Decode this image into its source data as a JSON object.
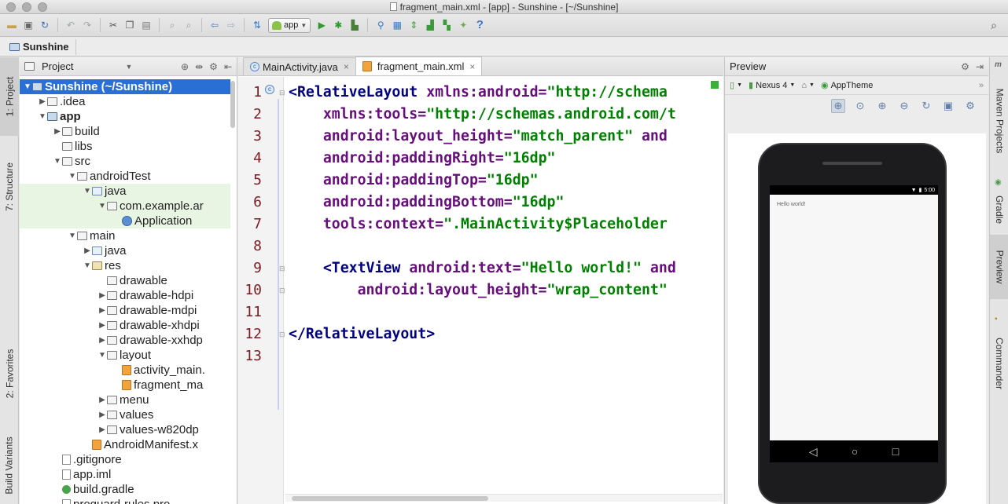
{
  "window": {
    "title": "fragment_main.xml - [app] - Sunshine - [~/Sunshine]"
  },
  "toolbar": {
    "run_config": "app",
    "help_glyph": "?"
  },
  "breadcrumb": {
    "project": "Sunshine"
  },
  "left_stripe": {
    "tabs": [
      "1: Project",
      "7: Structure",
      "2: Favorites",
      "Build Variants"
    ]
  },
  "project_panel": {
    "view": "Project",
    "tree": [
      {
        "label": "Sunshine (~/Sunshine)",
        "depth": 0,
        "expanded": true,
        "icon": "module-folder-icon",
        "selected": true
      },
      {
        "label": ".idea",
        "depth": 1,
        "expanded": false,
        "icon": "folder-icon"
      },
      {
        "label": "app",
        "depth": 1,
        "expanded": true,
        "icon": "module-folder-icon",
        "bold": true
      },
      {
        "label": "build",
        "depth": 2,
        "expanded": false,
        "icon": "folder-icon"
      },
      {
        "label": "libs",
        "depth": 2,
        "icon": "folder-icon"
      },
      {
        "label": "src",
        "depth": 2,
        "expanded": true,
        "icon": "folder-icon"
      },
      {
        "label": "androidTest",
        "depth": 3,
        "expanded": true,
        "icon": "folder-icon"
      },
      {
        "label": "java",
        "depth": 4,
        "expanded": true,
        "icon": "source-folder-icon",
        "green": true
      },
      {
        "label": "com.example.ar",
        "depth": 5,
        "expanded": true,
        "icon": "package-icon",
        "green": true
      },
      {
        "label": "Application",
        "depth": 6,
        "icon": "class-icon",
        "green": true
      },
      {
        "label": "main",
        "depth": 3,
        "expanded": true,
        "icon": "folder-icon"
      },
      {
        "label": "java",
        "depth": 4,
        "expanded": false,
        "icon": "source-folder-icon"
      },
      {
        "label": "res",
        "depth": 4,
        "expanded": true,
        "icon": "res-folder-icon"
      },
      {
        "label": "drawable",
        "depth": 5,
        "icon": "folder-icon"
      },
      {
        "label": "drawable-hdpi",
        "depth": 5,
        "expanded": false,
        "icon": "folder-icon"
      },
      {
        "label": "drawable-mdpi",
        "depth": 5,
        "expanded": false,
        "icon": "folder-icon"
      },
      {
        "label": "drawable-xhdpi",
        "depth": 5,
        "expanded": false,
        "icon": "folder-icon"
      },
      {
        "label": "drawable-xxhdp",
        "depth": 5,
        "expanded": false,
        "icon": "folder-icon"
      },
      {
        "label": "layout",
        "depth": 5,
        "expanded": true,
        "icon": "folder-icon"
      },
      {
        "label": "activity_main.",
        "depth": 6,
        "icon": "xml-file-icon"
      },
      {
        "label": "fragment_ma",
        "depth": 6,
        "icon": "xml-file-icon"
      },
      {
        "label": "menu",
        "depth": 5,
        "expanded": false,
        "icon": "folder-icon"
      },
      {
        "label": "values",
        "depth": 5,
        "expanded": false,
        "icon": "folder-icon"
      },
      {
        "label": "values-w820dp",
        "depth": 5,
        "expanded": false,
        "icon": "folder-icon"
      },
      {
        "label": "AndroidManifest.x",
        "depth": 4,
        "icon": "xml-file-icon"
      },
      {
        "label": ".gitignore",
        "depth": 2,
        "icon": "file-icon"
      },
      {
        "label": "app.iml",
        "depth": 2,
        "icon": "file-icon"
      },
      {
        "label": "build.gradle",
        "depth": 2,
        "icon": "gradle-icon"
      },
      {
        "label": "proguard-rules.pro",
        "depth": 2,
        "icon": "file-icon"
      }
    ]
  },
  "editor": {
    "tabs": [
      {
        "label": "MainActivity.java",
        "active": false,
        "icon": "java-class-icon"
      },
      {
        "label": "fragment_main.xml",
        "active": true,
        "icon": "xml-file-icon"
      }
    ],
    "close_glyph": "×",
    "line_numbers": [
      "1",
      "2",
      "3",
      "4",
      "5",
      "6",
      "7",
      "8",
      "9",
      "10",
      "11",
      "12",
      "13"
    ],
    "lines": [
      [
        {
          "t": "tag",
          "s": "<RelativeLayout "
        },
        {
          "t": "attr",
          "s": "xmlns:android="
        },
        {
          "t": "val",
          "s": "\"http://schema"
        }
      ],
      [
        {
          "t": "plain",
          "s": "    "
        },
        {
          "t": "attr",
          "s": "xmlns:tools="
        },
        {
          "t": "val",
          "s": "\"http://schemas.android.com/t"
        }
      ],
      [
        {
          "t": "plain",
          "s": "    "
        },
        {
          "t": "attr",
          "s": "android:layout_height="
        },
        {
          "t": "val",
          "s": "\"match_parent\""
        },
        {
          "t": "attr",
          "s": " and"
        }
      ],
      [
        {
          "t": "plain",
          "s": "    "
        },
        {
          "t": "attr",
          "s": "android:paddingRight="
        },
        {
          "t": "val",
          "s": "\"16dp\""
        }
      ],
      [
        {
          "t": "plain",
          "s": "    "
        },
        {
          "t": "attr",
          "s": "android:paddingTop="
        },
        {
          "t": "val",
          "s": "\"16dp\""
        }
      ],
      [
        {
          "t": "plain",
          "s": "    "
        },
        {
          "t": "attr",
          "s": "android:paddingBottom="
        },
        {
          "t": "val",
          "s": "\"16dp\""
        }
      ],
      [
        {
          "t": "plain",
          "s": "    "
        },
        {
          "t": "attr",
          "s": "tools:context="
        },
        {
          "t": "val",
          "s": "\".MainActivity$Placeholder"
        }
      ],
      [],
      [
        {
          "t": "plain",
          "s": "    "
        },
        {
          "t": "tag",
          "s": "<TextView "
        },
        {
          "t": "attr",
          "s": "android:text="
        },
        {
          "t": "val",
          "s": "\"Hello world!\""
        },
        {
          "t": "attr",
          "s": " and"
        }
      ],
      [
        {
          "t": "plain",
          "s": "        "
        },
        {
          "t": "attr",
          "s": "android:layout_height="
        },
        {
          "t": "val",
          "s": "\"wrap_content\""
        }
      ],
      [],
      [
        {
          "t": "tag",
          "s": "</RelativeLayout>"
        }
      ],
      []
    ]
  },
  "preview": {
    "title": "Preview",
    "device": "Nexus 4",
    "theme": "AppTheme",
    "status_time": "5:00",
    "hello_text": "Hello world!",
    "nav_back": "◁",
    "nav_home": "○",
    "nav_recent": "□"
  },
  "right_stripe": {
    "tabs": [
      "Maven Projects",
      "Gradle",
      "Preview",
      "Commander"
    ]
  }
}
